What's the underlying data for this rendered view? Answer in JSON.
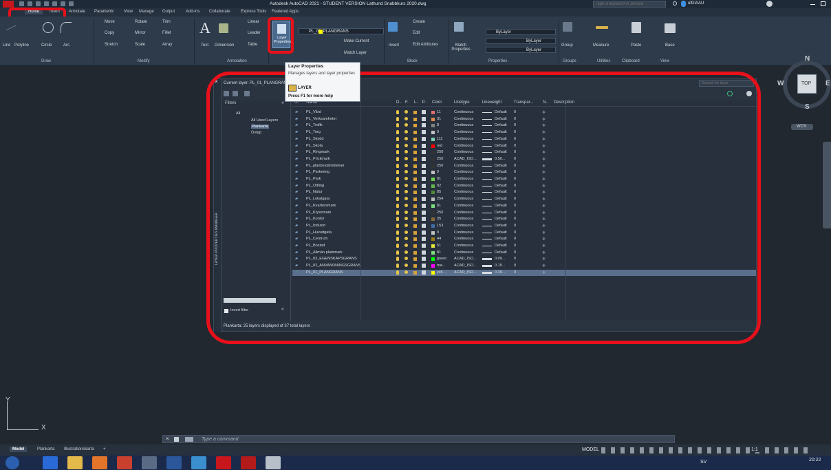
{
  "titlebar": {
    "title": "Autodesk AutoCAD 2021 - STUDENT VERSION   Lathund Snabbkurs 2020.dwg",
    "search_placeholder": "Type a keyword or phrase",
    "user": "ufDIAAU"
  },
  "ribbon_tabs": [
    "Home",
    "Insert",
    "Annotate",
    "Parametric",
    "View",
    "Manage",
    "Output",
    "Add-ins",
    "Collaborate",
    "Express Tools",
    "Featured Apps"
  ],
  "ribbon": {
    "draw": {
      "title": "Draw",
      "line": "Line",
      "polyline": "Polyline",
      "circle": "Circle",
      "arc": "Arc"
    },
    "modify": {
      "title": "Modify",
      "move": "Move",
      "rotate": "Rotate",
      "trim": "Trim",
      "copy": "Copy",
      "mirror": "Mirror",
      "fillet": "Fillet",
      "stretch": "Stretch",
      "scale": "Scale",
      "array": "Array"
    },
    "annotation": {
      "title": "Annotation",
      "text": "Text",
      "dimension": "Dimension",
      "linear": "Linear",
      "leader": "Leader",
      "table": "Table"
    },
    "layers": {
      "layer_properties": "Layer Properties",
      "current": "PL_01_PLANGRANS",
      "make_current": "Make Current",
      "match_layer": "Match Layer"
    },
    "block": {
      "title": "Block",
      "insert": "Insert",
      "create": "Create",
      "edit": "Edit",
      "edit_attributes": "Edit Attributes"
    },
    "properties": {
      "title": "Properties",
      "match": "Match Properties",
      "bylayer1": "ByLayer",
      "bylayer2": "ByLayer",
      "bylayer3": "ByLayer"
    },
    "groups": {
      "title": "Groups",
      "group": "Group"
    },
    "utilities": {
      "title": "Utilities",
      "measure": "Measure"
    },
    "clipboard": {
      "title": "Clipboard",
      "paste": "Paste"
    },
    "view": {
      "title": "View",
      "base": "Base"
    }
  },
  "tooltip": {
    "title": "Layer Properties",
    "desc": "Manages layers and layer properties",
    "command": "LAYER",
    "help": "Press F1 for more help"
  },
  "layer_manager": {
    "side_title": "LAYER PROPERTIES MANAGER",
    "current_layer": "Current layer: PL_01_PLANGRANS",
    "search_placeholder": "Search for layer",
    "filters_label": "Filters",
    "filter_tree": [
      "All",
      "All Used Layers",
      "Plankarta",
      "Övrigt"
    ],
    "invert_filter": "Invert filter",
    "status": "Plankarta: 25 layers displayed of 37 total layers",
    "columns": [
      "S..",
      "Name",
      "O..",
      "F..",
      "L..",
      "P..",
      "Color",
      "Linetype",
      "Lineweight",
      "Transpar...",
      "N..",
      "Description"
    ],
    "rows": [
      {
        "name": "PL_Vård",
        "color": "11",
        "hex": "#e07070",
        "linetype": "Continuous",
        "lw": "Default",
        "tr": "0"
      },
      {
        "name": "PL_Verksamheter",
        "color": "31",
        "hex": "#e08a4a",
        "linetype": "Continuous",
        "lw": "Default",
        "tr": "0"
      },
      {
        "name": "PL_Trafik",
        "color": "8",
        "hex": "#808080",
        "linetype": "Continuous",
        "lw": "Default",
        "tr": "0"
      },
      {
        "name": "PL_Torg",
        "color": "9",
        "hex": "#c0c0c0",
        "linetype": "Continuous",
        "lw": "Default",
        "tr": "0"
      },
      {
        "name": "PL_Skydd",
        "color": "111",
        "hex": "#7fd0b0",
        "linetype": "Continuous",
        "lw": "Default",
        "tr": "0"
      },
      {
        "name": "PL_Skola",
        "color": "red",
        "hex": "#ff0000",
        "linetype": "Continuous",
        "lw": "Default",
        "tr": "0"
      },
      {
        "name": "PL_Ringmark",
        "color": "250",
        "hex": "#333333",
        "linetype": "Continuous",
        "lw": "Default",
        "tr": "0"
      },
      {
        "name": "PL_Prickmark",
        "color": "250",
        "hex": "#333333",
        "linetype": "ACAD_ISO...",
        "lw": "0.50...",
        "tr": "0"
      },
      {
        "name": "PL_planbestämmelser",
        "color": "250",
        "hex": "#333333",
        "linetype": "Continuous",
        "lw": "Default",
        "tr": "0"
      },
      {
        "name": "PL_Parkering",
        "color": "9",
        "hex": "#c0c0c0",
        "linetype": "Continuous",
        "lw": "Default",
        "tr": "0"
      },
      {
        "name": "PL_Park",
        "color": "91",
        "hex": "#6fd24f",
        "linetype": "Continuous",
        "lw": "Default",
        "tr": "0"
      },
      {
        "name": "PL_Odling",
        "color": "92",
        "hex": "#62b84a",
        "linetype": "Continuous",
        "lw": "Default",
        "tr": "0"
      },
      {
        "name": "PL_Natur",
        "color": "85",
        "hex": "#4f8a3a",
        "linetype": "Continuous",
        "lw": "Default",
        "tr": "0"
      },
      {
        "name": "PL_Lokalgata",
        "color": "254",
        "hex": "#bdbdbd",
        "linetype": "Continuous",
        "lw": "Default",
        "tr": "0"
      },
      {
        "name": "PL_Kvartersmark",
        "color": "81",
        "hex": "#7be07b",
        "linetype": "Continuous",
        "lw": "Default",
        "tr": "0"
      },
      {
        "name": "PL_Kryssmark",
        "color": "250",
        "hex": "#333333",
        "linetype": "Continuous",
        "lw": "Default",
        "tr": "0"
      },
      {
        "name": "PL_Kontor",
        "color": "35",
        "hex": "#8a6a3a",
        "linetype": "Continuous",
        "lw": "Default",
        "tr": "0"
      },
      {
        "name": "PL_Industri",
        "color": "153",
        "hex": "#3f6fa8",
        "linetype": "Continuous",
        "lw": "Default",
        "tr": "0"
      },
      {
        "name": "PL_Huvudgata",
        "color": "9",
        "hex": "#c0c0c0",
        "linetype": "Continuous",
        "lw": "Default",
        "tr": "0"
      },
      {
        "name": "PL_Centrum",
        "color": "44",
        "hex": "#a07a10",
        "linetype": "Continuous",
        "lw": "Default",
        "tr": "0"
      },
      {
        "name": "PL_Bostad",
        "color": "51",
        "hex": "#e6e640",
        "linetype": "Continuous",
        "lw": "Default",
        "tr": "0"
      },
      {
        "name": "PL_Allmän platsmark",
        "color": "81",
        "hex": "#7be07b",
        "linetype": "Continuous",
        "lw": "Default",
        "tr": "0"
      },
      {
        "name": "PL_03_EGENSKAPSGRANS",
        "color": "green",
        "hex": "#00ff00",
        "linetype": "ACAD_ISO...",
        "lw": "0.09...",
        "tr": "0"
      },
      {
        "name": "PL_02_ANVANDNINGSGRANS",
        "color": "ma...",
        "hex": "#ff00ff",
        "linetype": "ACAD_ISO...",
        "lw": "0.15...",
        "tr": "0"
      },
      {
        "name": "PL_01_PLANGRANS",
        "color": "yell...",
        "hex": "#ffff00",
        "linetype": "ACAD_ISO...",
        "lw": "0.30...",
        "tr": "0"
      }
    ]
  },
  "viewcube": {
    "n": "N",
    "s": "S",
    "e": "E",
    "w": "W",
    "top": "TOP",
    "wcs": "WCS"
  },
  "ucs": {
    "x": "X",
    "y": "Y"
  },
  "command": {
    "placeholder": "Type a command"
  },
  "model_tabs": [
    "Model",
    "Plankarta",
    "Illustrationskarta"
  ],
  "status": {
    "model": "MODEL",
    "scale": "1:1",
    "lang": "SV",
    "time": "20:22"
  }
}
